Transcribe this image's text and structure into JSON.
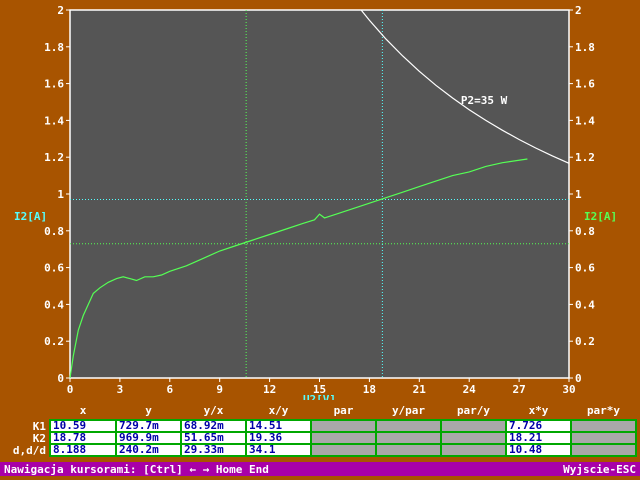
{
  "chart_data": {
    "type": "line",
    "xlabel": "U2[V]",
    "ylabel_left": "I2[A]",
    "ylabel_right": "I2[A]",
    "xlim": [
      0,
      30
    ],
    "ylim": [
      0,
      2
    ],
    "xticks": [
      "0",
      "3",
      "6",
      "9",
      "12",
      "15",
      "18",
      "21",
      "24",
      "27",
      "30"
    ],
    "yticks": [
      "0",
      "0.2",
      "0.4",
      "0.6",
      "0.8",
      "1",
      "1.2",
      "1.4",
      "1.6",
      "1.8",
      "2"
    ],
    "grid": false,
    "plot_bg": "#555555",
    "series": [
      {
        "color": "#55ff55",
        "x": [
          0,
          0.2,
          0.5,
          0.8,
          1.1,
          1.4,
          1.8,
          2.3,
          2.8,
          3.2,
          3.6,
          4.0,
          4.5,
          5.0,
          5.5,
          6.0,
          7.0,
          8.0,
          9.0,
          10.0,
          11.0,
          12.0,
          13.0,
          14.0,
          14.7,
          15.0,
          15.3,
          16.0,
          17.0,
          18.0,
          19.0,
          20.0,
          21.0,
          22.0,
          23.0,
          24.0,
          25.0,
          26.0,
          27.5
        ],
        "y": [
          0.0,
          0.12,
          0.26,
          0.34,
          0.4,
          0.46,
          0.49,
          0.52,
          0.54,
          0.55,
          0.54,
          0.53,
          0.55,
          0.55,
          0.56,
          0.58,
          0.61,
          0.65,
          0.69,
          0.72,
          0.75,
          0.78,
          0.81,
          0.84,
          0.86,
          0.89,
          0.87,
          0.89,
          0.92,
          0.95,
          0.98,
          1.01,
          1.04,
          1.07,
          1.1,
          1.12,
          1.15,
          1.17,
          1.19
        ]
      },
      {
        "name": "P2=35 W",
        "color": "#ffffff",
        "x": [
          17.5,
          18,
          19,
          20,
          21,
          22,
          23,
          24,
          25,
          26,
          27,
          28,
          29,
          30
        ],
        "y": [
          2.0,
          1.944,
          1.842,
          1.75,
          1.667,
          1.591,
          1.522,
          1.458,
          1.4,
          1.346,
          1.296,
          1.25,
          1.207,
          1.167
        ]
      }
    ],
    "cursors": {
      "k1": {
        "x": 10.59,
        "y": 0.7297,
        "color": "#55ff55"
      },
      "k2": {
        "x": 18.78,
        "y": 0.9699,
        "color": "#55ffff"
      }
    }
  },
  "table": {
    "headers": [
      "x",
      "y",
      "y/x",
      "x/y",
      "par",
      "y/par",
      "par/y",
      "x*y",
      "par*y"
    ],
    "rows": [
      {
        "label": "K1",
        "cells": [
          "10.59",
          "729.7m",
          "68.92m",
          "14.51",
          "",
          "",
          "",
          "7.726",
          ""
        ]
      },
      {
        "label": "K2",
        "cells": [
          "18.78",
          "969.9m",
          "51.65m",
          "19.36",
          "",
          "",
          "",
          "18.21",
          ""
        ]
      },
      {
        "label": "d,d/d",
        "cells": [
          "8.188",
          "240.2m",
          "29.33m",
          "34.1",
          "",
          "",
          "",
          "10.48",
          ""
        ]
      }
    ]
  },
  "status": {
    "left": "Nawigacja kursorami: [Ctrl] ← → Home End",
    "right": "Wyjscie-ESC"
  }
}
